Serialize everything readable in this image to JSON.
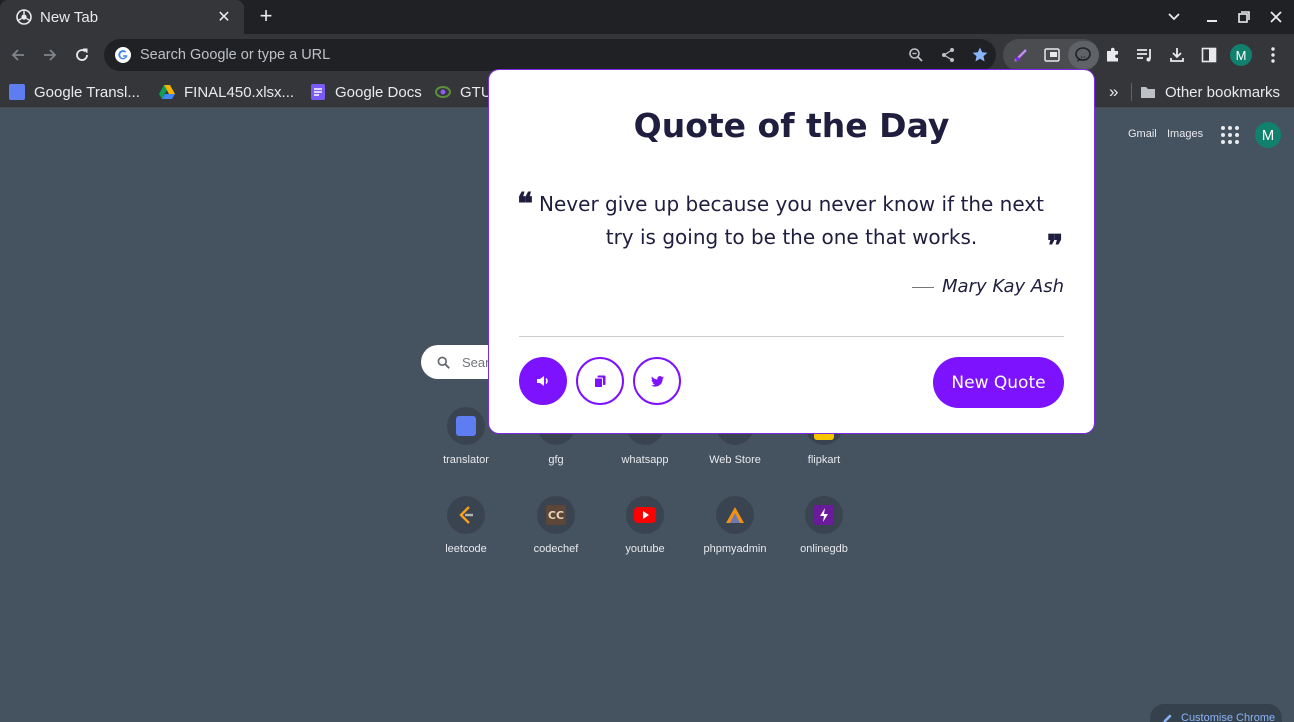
{
  "browser": {
    "tab": {
      "title": "New Tab"
    },
    "omnibox": {
      "placeholder": "Search Google or type a URL"
    },
    "profile_initial": "M"
  },
  "bookmarks": {
    "items": [
      {
        "label": "Google Transl...",
        "icon": "google-translate-icon",
        "color": "#5e7df0"
      },
      {
        "label": "FINAL450.xlsx...",
        "icon": "google-drive-icon",
        "color": "#f4b400"
      },
      {
        "label": "Google Docs",
        "icon": "google-docs-icon",
        "color": "#7a5af8"
      },
      {
        "label": "GTU",
        "icon": "gtu-icon",
        "color": "#5a8f3a"
      }
    ],
    "overflow": "»",
    "other": "Other bookmarks"
  },
  "ntp": {
    "links": {
      "gmail": "Gmail",
      "images": "Images"
    },
    "profile_initial": "M",
    "search_placeholder": "Sear",
    "shortcuts": [
      {
        "label": "translator",
        "icon": "translate-icon"
      },
      {
        "label": "gfg",
        "icon": "gfg-icon"
      },
      {
        "label": "whatsapp",
        "icon": "whatsapp-icon"
      },
      {
        "label": "Web Store",
        "icon": "web-store-icon"
      },
      {
        "label": "flipkart",
        "icon": "flipkart-icon"
      },
      {
        "label": "leetcode",
        "icon": "leetcode-icon"
      },
      {
        "label": "codechef",
        "icon": "codechef-icon"
      },
      {
        "label": "youtube",
        "icon": "youtube-icon"
      },
      {
        "label": "phpmyadmin",
        "icon": "phpmyadmin-icon"
      },
      {
        "label": "onlinegdb",
        "icon": "onlinegdb-icon"
      }
    ],
    "customise": "Customise Chrome"
  },
  "quote": {
    "title": "Quote of the Day",
    "text": "Never give up because you never know if the next try is going to be the one that works.",
    "author": "Mary Kay Ash",
    "new_quote_label": "New Quote",
    "accent": "#7d12ff"
  }
}
